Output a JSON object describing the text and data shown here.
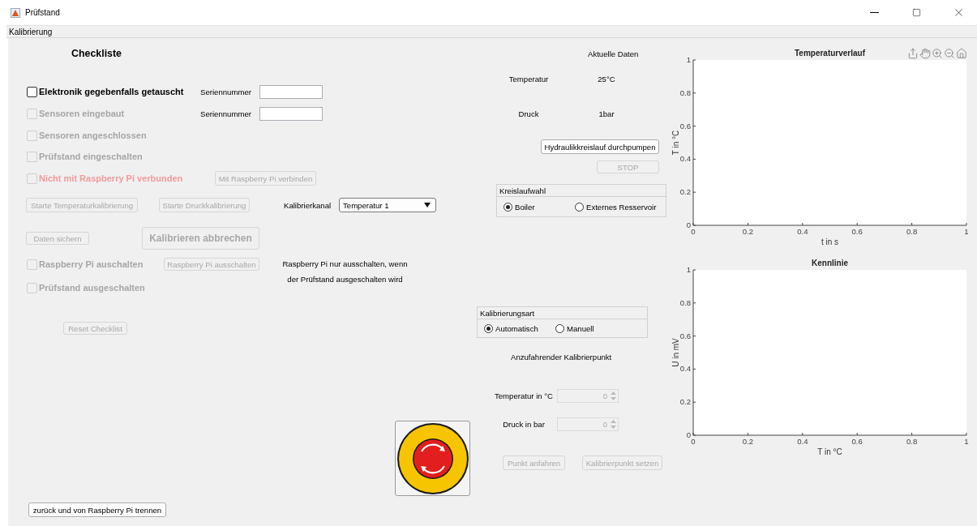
{
  "window": {
    "title": "Prüfstand"
  },
  "menu": [
    {
      "label": "Kalibrierung"
    }
  ],
  "checklist": {
    "title": "Checkliste"
  },
  "left_rows": [
    {
      "cells": [
        {
          "kind": "checkbox",
          "label": "Elektronik gegebenfalls getauscht",
          "checked": false,
          "disabled": false,
          "alert": false
        },
        {
          "kind": "label",
          "text": "Seriennummer"
        },
        {
          "kind": "field"
        }
      ]
    },
    {
      "cells": [
        {
          "kind": "checkbox",
          "label": "Sensoren eingebaut",
          "checked": false,
          "disabled": true,
          "alert": false
        },
        {
          "kind": "label",
          "text": "Seriennummer"
        },
        {
          "kind": "field"
        }
      ]
    },
    {
      "cells": [
        {
          "kind": "checkbox",
          "label": "Sensoren angeschlossen",
          "checked": false,
          "disabled": true,
          "alert": false
        }
      ]
    },
    {
      "cells": [
        {
          "kind": "checkbox",
          "label": "Prüfstand eingeschalten",
          "checked": false,
          "disabled": true,
          "alert": false
        }
      ]
    },
    {
      "cells": [
        {
          "kind": "checkbox",
          "label": "Nicht mit Raspberry Pi verbunden",
          "checked": false,
          "disabled": true,
          "alert": true
        },
        {
          "kind": "button",
          "label": "Mit Raspberry Pi verbinden",
          "disabled": true
        }
      ]
    },
    {
      "cells": [
        {
          "kind": "button",
          "label": "Starte Temperaturkalibrierung",
          "disabled": true
        },
        {
          "kind": "button",
          "label": "Starte Druckkalibrierung",
          "disabled": true
        },
        {
          "kind": "label",
          "text": "Kalibrierkanal"
        },
        {
          "kind": "dropdown",
          "value": "Temperatur 1"
        }
      ]
    },
    {
      "cells": [
        {
          "kind": "button",
          "label": "Daten sichern",
          "disabled": true
        },
        {
          "kind": "big_button",
          "label": "Kalibrieren abbrechen",
          "disabled": true
        }
      ]
    },
    {
      "cells": [
        {
          "kind": "checkbox",
          "label": "Raspberry Pi auschalten",
          "checked": false,
          "disabled": true,
          "alert": false
        },
        {
          "kind": "button",
          "label": "Raspberry Pi ausschalten",
          "disabled": true
        },
        {
          "kind": "note",
          "text": "Raspberry Pi nur ausschalten, wenn\nder Prüfstand ausgeschalten wird"
        }
      ]
    },
    {
      "cells": [
        {
          "kind": "checkbox",
          "label": "Prüfstand ausgeschalten",
          "checked": false,
          "disabled": true,
          "alert": false
        }
      ]
    },
    {
      "cells": [
        {
          "kind": "button",
          "label": "Reset Checklist",
          "disabled": true
        }
      ]
    },
    {
      "cells": [
        {
          "kind": "estop",
          "disabled": false
        }
      ]
    },
    {
      "cells": [
        {
          "kind": "button",
          "label": "zurück und von Raspberry Pi trennen",
          "disabled": false
        }
      ]
    }
  ],
  "current_data": {
    "title": "Aktuelle Daten",
    "rows": [
      {
        "label": "Temperatur",
        "value": "25°C"
      },
      {
        "label": "Druck",
        "value": "1bar"
      }
    ]
  },
  "pump_button": {
    "label": "Hydraulikkreislauf durchpumpen",
    "disabled": false
  },
  "stop_button": {
    "label": "STOP",
    "disabled": true
  },
  "circuit": {
    "title": "Kreislaufwahl",
    "options": [
      {
        "label": "Boiler",
        "selected": true
      },
      {
        "label": "Externes Resservoir",
        "selected": false
      }
    ]
  },
  "calibration_mode": {
    "title": "Kalibrierungsart",
    "options": [
      {
        "label": "Automatisch",
        "selected": true
      },
      {
        "label": "Manuell",
        "selected": false
      }
    ]
  },
  "target_point": {
    "title": "Anzufahrender Kalibrierpunkt",
    "spinners": [
      {
        "label": "Temperatur in °C",
        "value": "0",
        "disabled": true
      },
      {
        "label": "Druck in bar",
        "value": "0",
        "disabled": true
      }
    ]
  },
  "point_buttons": [
    {
      "label": "Punkt anfahren",
      "disabled": true
    },
    {
      "label": "Kalibrierpunkt setzen",
      "disabled": true
    }
  ],
  "charts": [
    {
      "chart_data": {
        "type": "line",
        "title": "Temperaturverlauf",
        "xlabel": "t in s",
        "ylabel": "T in °C",
        "xlim": [
          0,
          1
        ],
        "ylim": [
          0,
          1
        ],
        "xticks": [
          0,
          0.2,
          0.4,
          0.6,
          0.8,
          1
        ],
        "yticks": [
          0,
          0.2,
          0.4,
          0.6,
          0.8,
          1
        ]
      }
    },
    {
      "chart_data": {
        "type": "line",
        "title": "Kennlinie",
        "xlabel": "T in °C",
        "ylabel": "U in mV",
        "xlim": [
          0,
          1
        ],
        "ylim": [
          0,
          1
        ],
        "xticks": [
          0,
          0.2,
          0.4,
          0.6,
          0.8,
          1
        ],
        "yticks": [
          0,
          0.2,
          0.4,
          0.6,
          0.8,
          1
        ]
      }
    }
  ]
}
